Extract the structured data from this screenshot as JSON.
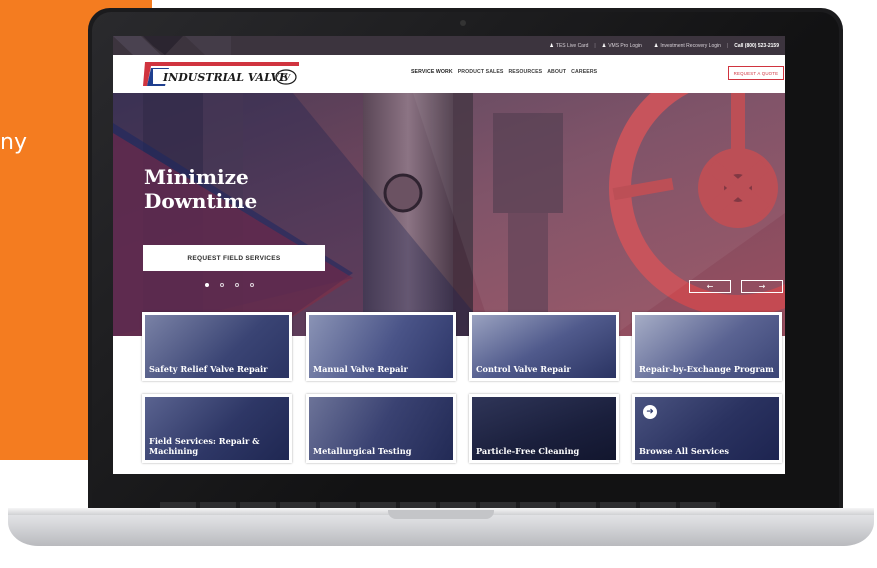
{
  "side_panel": {
    "partial_text": "ny"
  },
  "topbar": {
    "links": [
      {
        "label": "TES Live Card",
        "icon": "user-icon"
      },
      {
        "label": "VMS Pro Login",
        "icon": "user-lock-icon"
      },
      {
        "label": "Investment Recovery Login",
        "icon": "user-lock-icon"
      }
    ],
    "call_label": "Call (800) 523-2159"
  },
  "header": {
    "logo_text": "INDUSTRIAL VALVE",
    "logo_badge": "IV",
    "nav": [
      {
        "label": "SERVICE WORK"
      },
      {
        "label": "PRODUCT SALES"
      },
      {
        "label": "RESOURCES"
      },
      {
        "label": "ABOUT"
      },
      {
        "label": "CAREERS"
      }
    ],
    "quote_button": "REQUEST A QUOTE"
  },
  "hero": {
    "title": "Minimize Downtime",
    "cta": "REQUEST FIELD SERVICES",
    "slide_count": 4,
    "active_slide": 1,
    "prev_icon": "←",
    "next_icon": "→"
  },
  "services": [
    {
      "label": "Safety Relief Valve Repair"
    },
    {
      "label": "Manual Valve Repair"
    },
    {
      "label": "Control Valve Repair"
    },
    {
      "label": "Repair-by-Exchange Program"
    },
    {
      "label": "Field Services: Repair & Machining"
    },
    {
      "label": "Metallurgical Testing"
    },
    {
      "label": "Particle-Free Cleaning"
    },
    {
      "label": "Browse All Services",
      "icon": "arrow-right-circle-icon"
    }
  ],
  "colors": {
    "orange": "#f47c20",
    "brand_red": "#d0343f",
    "brand_blue": "#1f3f8f",
    "topbar": "#3c343e"
  }
}
